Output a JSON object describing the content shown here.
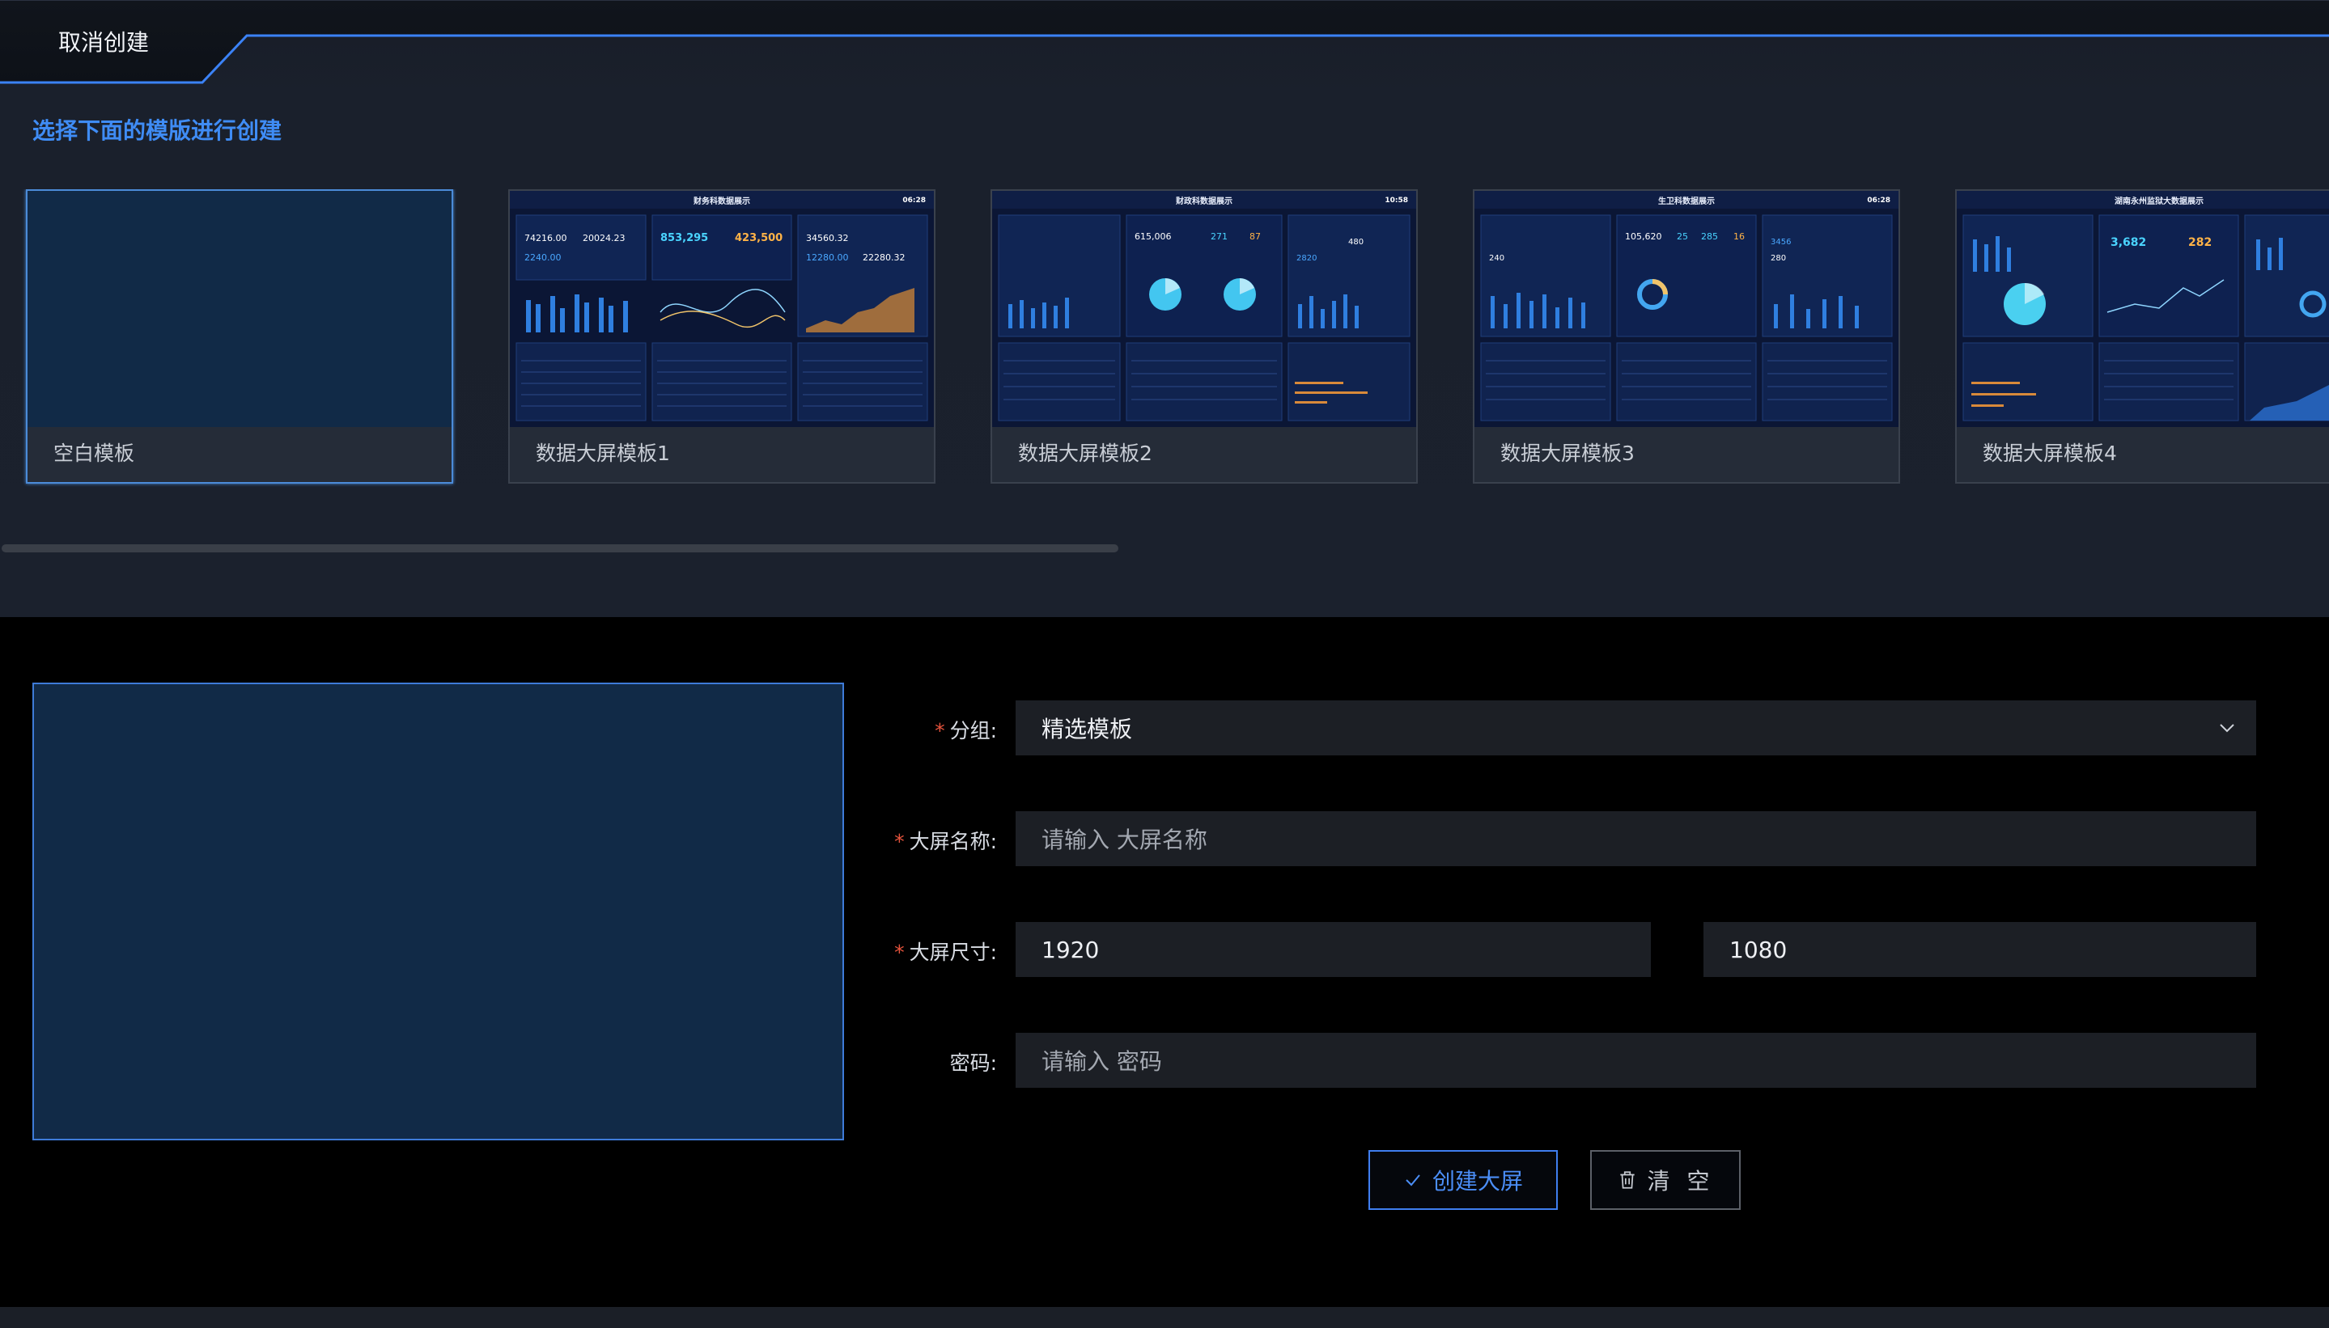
{
  "header": {
    "cancel_label": "取消创建",
    "accent_color": "#3f8cf5"
  },
  "templates": {
    "title": "选择下面的模版进行创建",
    "items": [
      {
        "label": "空白模板",
        "selected": true
      },
      {
        "label": "数据大屏模板1",
        "selected": false
      },
      {
        "label": "数据大屏模板2",
        "selected": false
      },
      {
        "label": "数据大屏模板3",
        "selected": false
      },
      {
        "label": "数据大屏模板4",
        "selected": false
      }
    ],
    "thumb_titles": [
      "财务科数据展示",
      "财政科数据展示",
      "生卫科数据展示",
      "湖南永州监狱大数据展示"
    ],
    "thumb_times": [
      "06:28",
      "10:58",
      "06:28",
      ""
    ],
    "thumb_numbers": [
      [
        "74216.00",
        "20024.23",
        "853,295",
        "423,500",
        "34560.32",
        "2240.00",
        "12280.00",
        "22280.32"
      ],
      [
        "615,006",
        "271",
        "87",
        "480",
        "2820"
      ],
      [
        "105,620",
        "25",
        "285",
        "16",
        "3456",
        "240",
        "280"
      ],
      [
        "3,682",
        "282"
      ]
    ]
  },
  "form": {
    "group": {
      "label": "分组:",
      "value": "精选模板",
      "required": true
    },
    "name": {
      "label": "大屏名称:",
      "placeholder": "请输入 大屏名称",
      "required": true
    },
    "size": {
      "label": "大屏尺寸:",
      "width": "1920",
      "height": "1080",
      "required": true
    },
    "password": {
      "label": "密码:",
      "placeholder": "请输入 密码",
      "required": false
    }
  },
  "actions": {
    "create_label": "创建大屏",
    "clear_label": "清 空"
  }
}
